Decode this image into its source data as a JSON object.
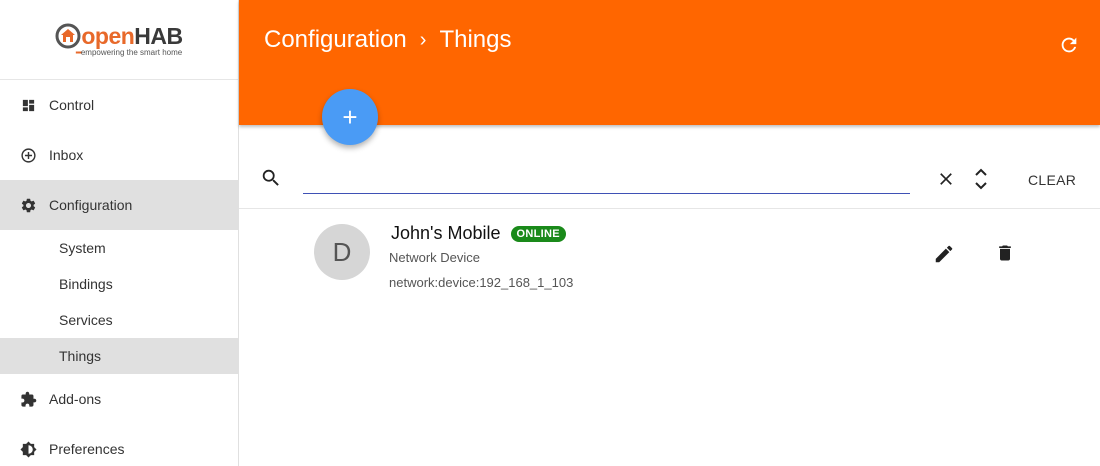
{
  "app": {
    "logo_open": "open",
    "logo_hab": "HAB",
    "logo_tagline": "empowering the smart home"
  },
  "sidebar": {
    "items": [
      {
        "label": "Control",
        "icon": "dashboard-icon"
      },
      {
        "label": "Inbox",
        "icon": "add-circle-icon"
      },
      {
        "label": "Configuration",
        "icon": "gear-icon"
      },
      {
        "label": "Add-ons",
        "icon": "puzzle-icon"
      },
      {
        "label": "Preferences",
        "icon": "brightness-icon"
      }
    ],
    "sub_items": [
      "System",
      "Bindings",
      "Services",
      "Things"
    ]
  },
  "header": {
    "breadcrumb_root": "Configuration",
    "breadcrumb_sep": "›",
    "breadcrumb_current": "Things",
    "accent_color": "#ff6600"
  },
  "fab": {
    "label": "+"
  },
  "search": {
    "value": "",
    "placeholder": "",
    "clear_label": "CLEAR"
  },
  "things": [
    {
      "avatar_letter": "D",
      "name": "John's Mobile",
      "status": "ONLINE",
      "type": "Network Device",
      "uid": "network:device:192_168_1_103"
    }
  ]
}
